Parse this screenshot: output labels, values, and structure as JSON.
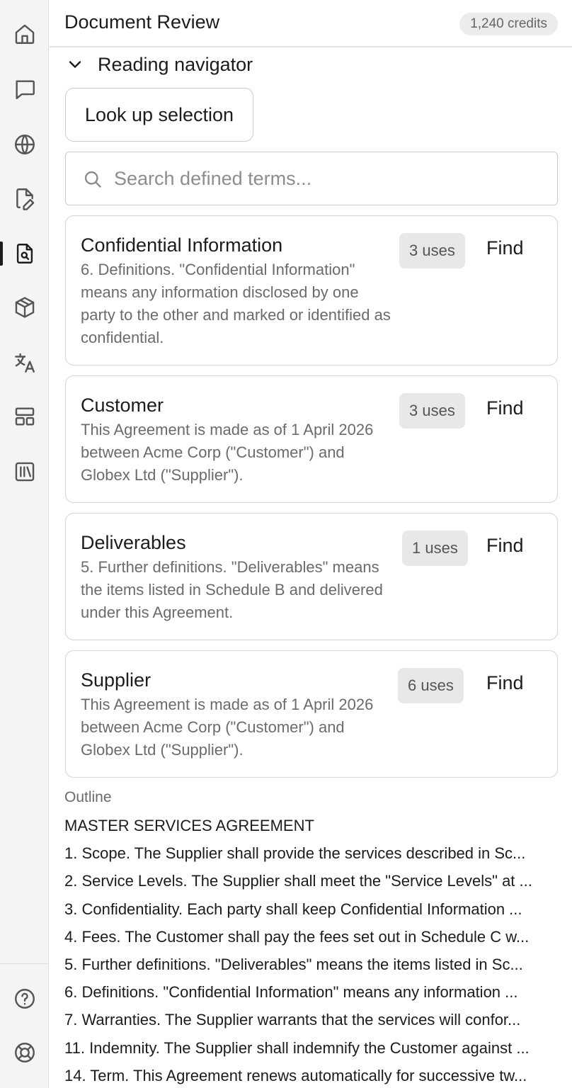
{
  "sidebar": {
    "items": [
      {
        "icon": "home-icon"
      },
      {
        "icon": "chat-icon"
      },
      {
        "icon": "globe-icon"
      },
      {
        "icon": "file-edit-icon"
      },
      {
        "icon": "file-search-icon",
        "active": true
      },
      {
        "icon": "cube-icon"
      },
      {
        "icon": "translate-icon"
      },
      {
        "icon": "layout-icon"
      },
      {
        "icon": "library-icon"
      }
    ],
    "bottom_items": [
      {
        "icon": "help-icon"
      },
      {
        "icon": "support-icon"
      }
    ]
  },
  "header": {
    "title": "Document Review",
    "credits": "1,240 credits"
  },
  "navigator": {
    "section_title": "Reading navigator",
    "lookup_label": "Look up selection",
    "search_placeholder": "Search defined terms...",
    "find_label": "Find",
    "terms": [
      {
        "name": "Confidential Information",
        "uses": "3 uses",
        "definition": "6. Definitions. \"Confidential Information\" means any information disclosed by one party to the other and marked or identified as confidential."
      },
      {
        "name": "Customer",
        "uses": "3 uses",
        "definition": "This Agreement is made as of 1 April 2026 between Acme Corp (\"Customer\") and Globex Ltd (\"Supplier\")."
      },
      {
        "name": "Deliverables",
        "uses": "1 uses",
        "definition": "5. Further definitions. \"Deliverables\" means the items listed in Schedule B and delivered under this Agreement."
      },
      {
        "name": "Supplier",
        "uses": "6 uses",
        "definition": "This Agreement is made as of 1 April 2026 between Acme Corp (\"Customer\") and Globex Ltd (\"Supplier\")."
      }
    ]
  },
  "outline": {
    "label": "Outline",
    "items": [
      "MASTER SERVICES AGREEMENT",
      "1. Scope. The Supplier shall provide the services described in Sc...",
      "2. Service Levels. The Supplier shall meet the \"Service Levels\" at ...",
      "3. Confidentiality. Each party shall keep Confidential Information ...",
      "4. Fees. The Customer shall pay the fees set out in Schedule C w...",
      "5. Further definitions. \"Deliverables\" means the items listed in Sc...",
      "6. Definitions. \"Confidential Information\" means any information ...",
      "7. Warranties. The Supplier warrants that the services will confor...",
      "11. Indemnity. The Supplier shall indemnify the Customer against ...",
      "14. Term. This Agreement renews automatically for successive tw..."
    ]
  }
}
